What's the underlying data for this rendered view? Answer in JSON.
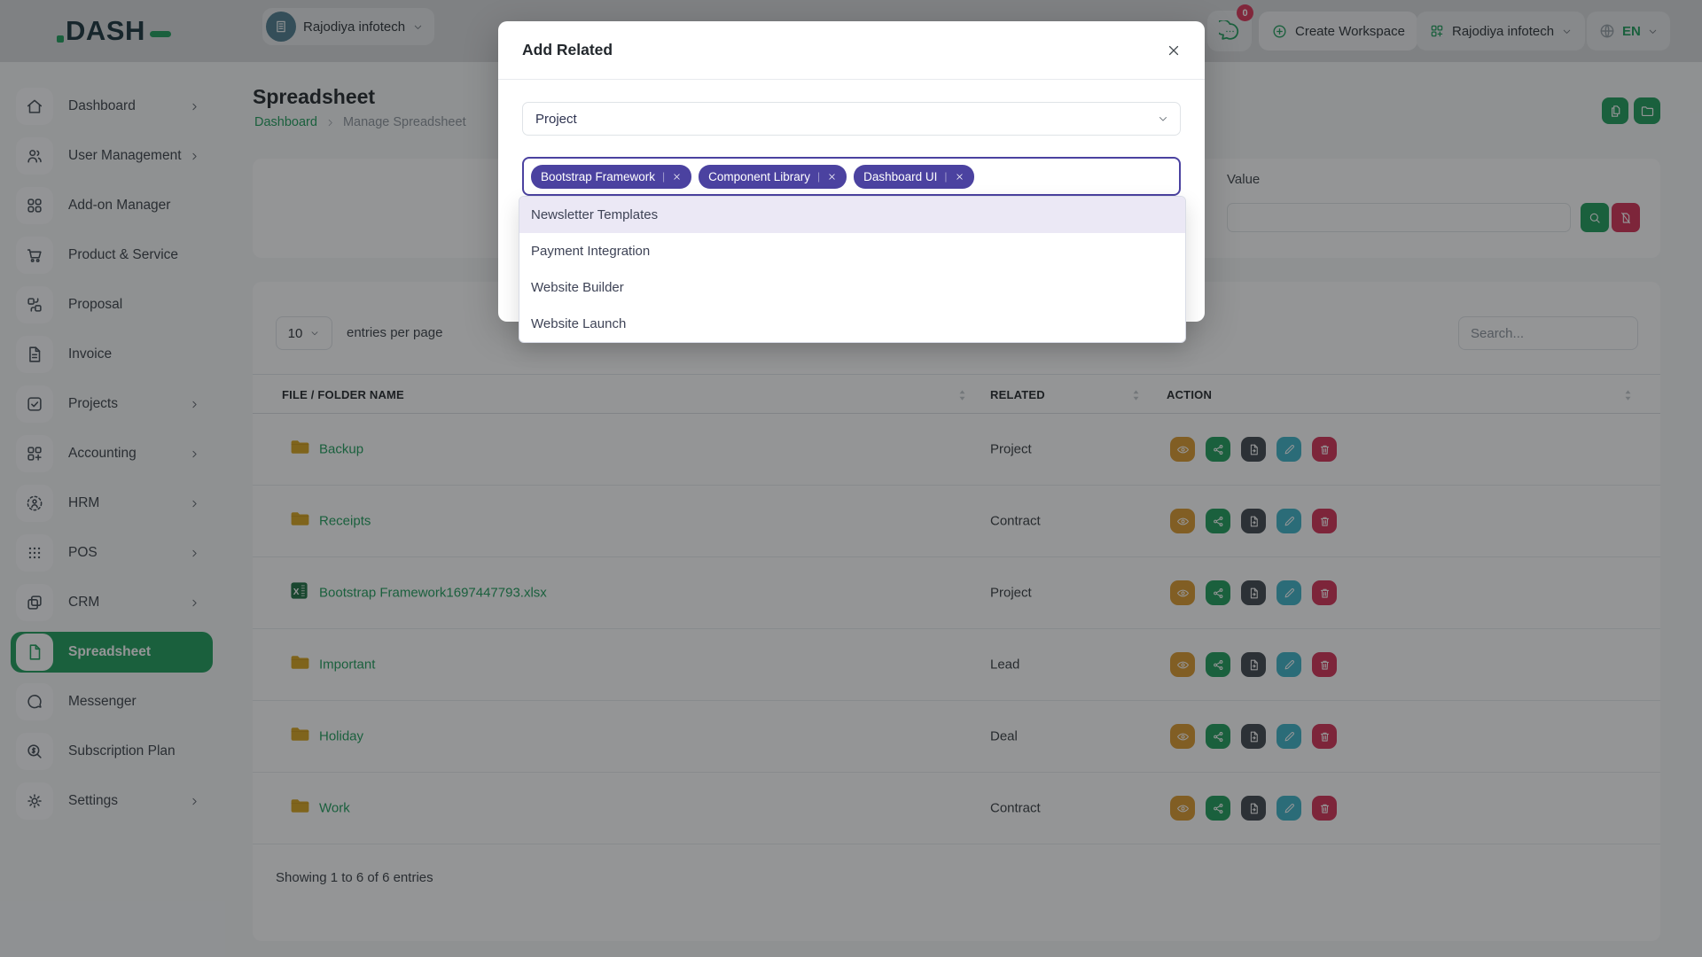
{
  "colors": {
    "primary_green": "#1f9d5b",
    "tag_purple": "#4b42a0",
    "danger_red": "#d43056",
    "warning_orange": "#dd9a2e",
    "info_teal": "#3eb4c8",
    "dark_gray": "#40474e",
    "folder_amber": "#d9a41f"
  },
  "header": {
    "logo_text": "DASH",
    "workspace_name": "Rajodiya infotech",
    "chat_badge": "0",
    "create_workspace_label": "Create Workspace",
    "account_name": "Rajodiya infotech",
    "language": "EN"
  },
  "sidebar": {
    "items": [
      {
        "label": "Dashboard",
        "has_submenu": true
      },
      {
        "label": "User Management",
        "has_submenu": true
      },
      {
        "label": "Add-on Manager",
        "has_submenu": false
      },
      {
        "label": "Product & Service",
        "has_submenu": false
      },
      {
        "label": "Proposal",
        "has_submenu": false
      },
      {
        "label": "Invoice",
        "has_submenu": false
      },
      {
        "label": "Projects",
        "has_submenu": true
      },
      {
        "label": "Accounting",
        "has_submenu": true
      },
      {
        "label": "HRM",
        "has_submenu": true
      },
      {
        "label": "POS",
        "has_submenu": true
      },
      {
        "label": "CRM",
        "has_submenu": true
      },
      {
        "label": "Spreadsheet",
        "has_submenu": false,
        "active": true
      },
      {
        "label": "Messenger",
        "has_submenu": false
      },
      {
        "label": "Subscription Plan",
        "has_submenu": false
      },
      {
        "label": "Settings",
        "has_submenu": true
      }
    ]
  },
  "page": {
    "title": "Spreadsheet",
    "breadcrumb_home": "Dashboard",
    "breadcrumb_current": "Manage Spreadsheet"
  },
  "filter": {
    "value_label": "Value",
    "value_input": ""
  },
  "table": {
    "per_page": "10",
    "per_page_label": "entries per page",
    "search_placeholder": "Search...",
    "columns": [
      "FILE / FOLDER NAME",
      "RELATED",
      "ACTION"
    ],
    "rows": [
      {
        "name": "Backup",
        "icon": "folder",
        "related": "Project"
      },
      {
        "name": "Receipts",
        "icon": "folder",
        "related": "Contract"
      },
      {
        "name": "Bootstrap Framework1697447793.xlsx",
        "icon": "excel",
        "related": "Project"
      },
      {
        "name": "Important",
        "icon": "folder",
        "related": "Lead"
      },
      {
        "name": "Holiday",
        "icon": "folder",
        "related": "Deal"
      },
      {
        "name": "Work",
        "icon": "folder",
        "related": "Contract"
      }
    ],
    "footer": "Showing 1 to 6 of 6 entries"
  },
  "modal": {
    "title": "Add Related",
    "select_value": "Project",
    "tags": [
      "Bootstrap Framework",
      "Component Library",
      "Dashboard UI"
    ],
    "options": [
      "Newsletter Templates",
      "Payment Integration",
      "Website Builder",
      "Website Launch"
    ],
    "highlighted_option": "Newsletter Templates"
  }
}
